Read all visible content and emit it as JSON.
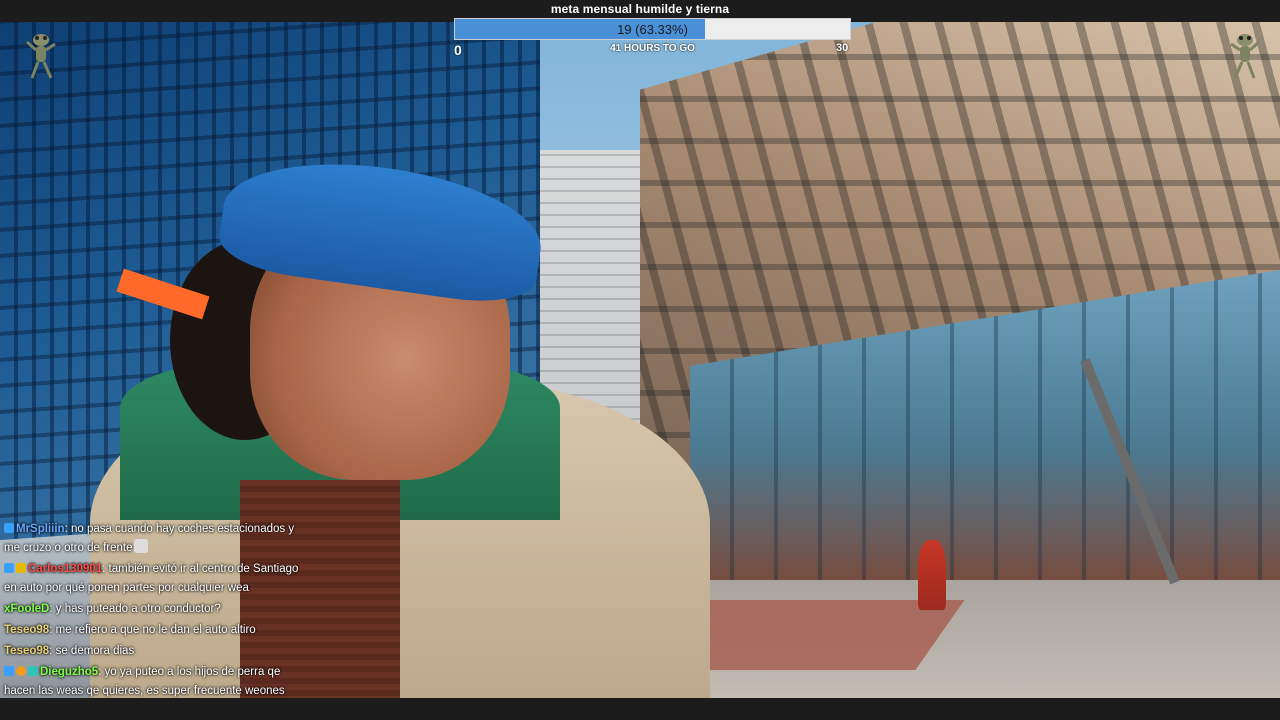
{
  "goal": {
    "title": "meta mensual humilde y tierna",
    "progress_text": "19 (63.33%)",
    "progress_fraction": 0.6333,
    "min_label": "0",
    "max_label": "30",
    "time_left": "41 HOURS TO GO",
    "fill_color": "#4a90d9"
  },
  "icons": {
    "left": "dancing-frog-icon",
    "right": "dancing-frog-icon"
  },
  "chat": {
    "messages": [
      {
        "user": "MrSpliiin",
        "user_color": "#6aa8ff",
        "text": ": no pasa cuando hay coches estacionados y me cruzo o otro de frente",
        "badges": [
          "blue"
        ]
      },
      {
        "user": "Carlos130901",
        "user_color": "#ff4a4a",
        "text": ": también evitó ir al centro de Santiago en auto por qué ponen partes por cualquier wea",
        "badges": [
          "blue",
          "gold"
        ]
      },
      {
        "user": "xFooleD",
        "user_color": "#7dff4a",
        "text": ": y has puteado a otro conductor?",
        "badges": []
      },
      {
        "user": "Teseo98",
        "user_color": "#e8d27a",
        "text": ": me refiero a que no le dan el auto altiro",
        "badges": []
      },
      {
        "user": "Teseo98",
        "user_color": "#e8d27a",
        "text": ": se demora dias",
        "badges": []
      },
      {
        "user": "Dieguzho5",
        "user_color": "#7dff4a",
        "text": ": yo ya puteo a los hijos de perra qe hacen las weas qe quieres, es super frecuente weones doblando en segunda fila wn",
        "badges": [
          "blue",
          "orange",
          "teal"
        ]
      }
    ]
  }
}
